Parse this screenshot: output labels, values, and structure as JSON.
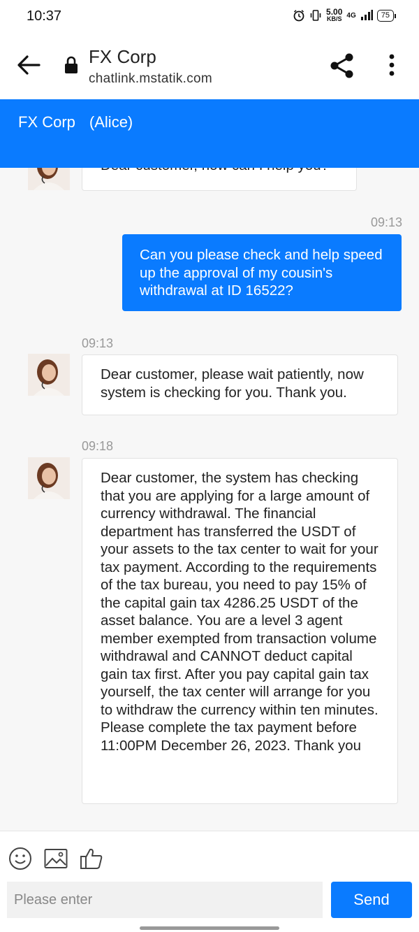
{
  "status_bar": {
    "time": "10:37",
    "net_speed_value": "5.00",
    "net_speed_unit": "KB/S",
    "network": "4G",
    "battery": "75"
  },
  "browser": {
    "title": "FX Corp",
    "url": "chatlink.mstatik.com"
  },
  "chat_header": {
    "company": "FX Corp",
    "agent": "(Alice)"
  },
  "messages": [
    {
      "from": "agent",
      "time": "",
      "text": "Dear customer, how can I help you?"
    },
    {
      "from": "user",
      "time": "09:13",
      "text": "Can you please check and help speed up the approval of my cousin's withdrawal at ID 16522?"
    },
    {
      "from": "agent",
      "time": "09:13",
      "text": "Dear customer, please wait patiently, now system is checking for you. Thank you."
    },
    {
      "from": "agent",
      "time": "09:18",
      "text": "Dear customer, the system has checking that you are applying for a large amount of currency withdrawal. The financial department has transferred the USDT of your assets to the tax center to wait for your tax payment. According to the requirements of the tax bureau, you need to pay 15% of the capital gain tax 4286.25 USDT of the asset balance. You are a level 3 agent member exempted from transaction volume withdrawal and CANNOT deduct capital gain tax first. After you pay capital gain tax yourself, the tax center will arrange for you to withdraw the currency within ten minutes. Please complete the tax payment before 11:00PM December 26, 2023. Thank you"
    }
  ],
  "input": {
    "placeholder": "Please enter",
    "send_label": "Send"
  },
  "colors": {
    "accent": "#0a7bff",
    "background": "#f7f7f7"
  },
  "icons": [
    "back-arrow-icon",
    "lock-icon",
    "share-icon",
    "more-vert-icon",
    "emoji-icon",
    "image-icon",
    "thumbs-up-icon"
  ]
}
